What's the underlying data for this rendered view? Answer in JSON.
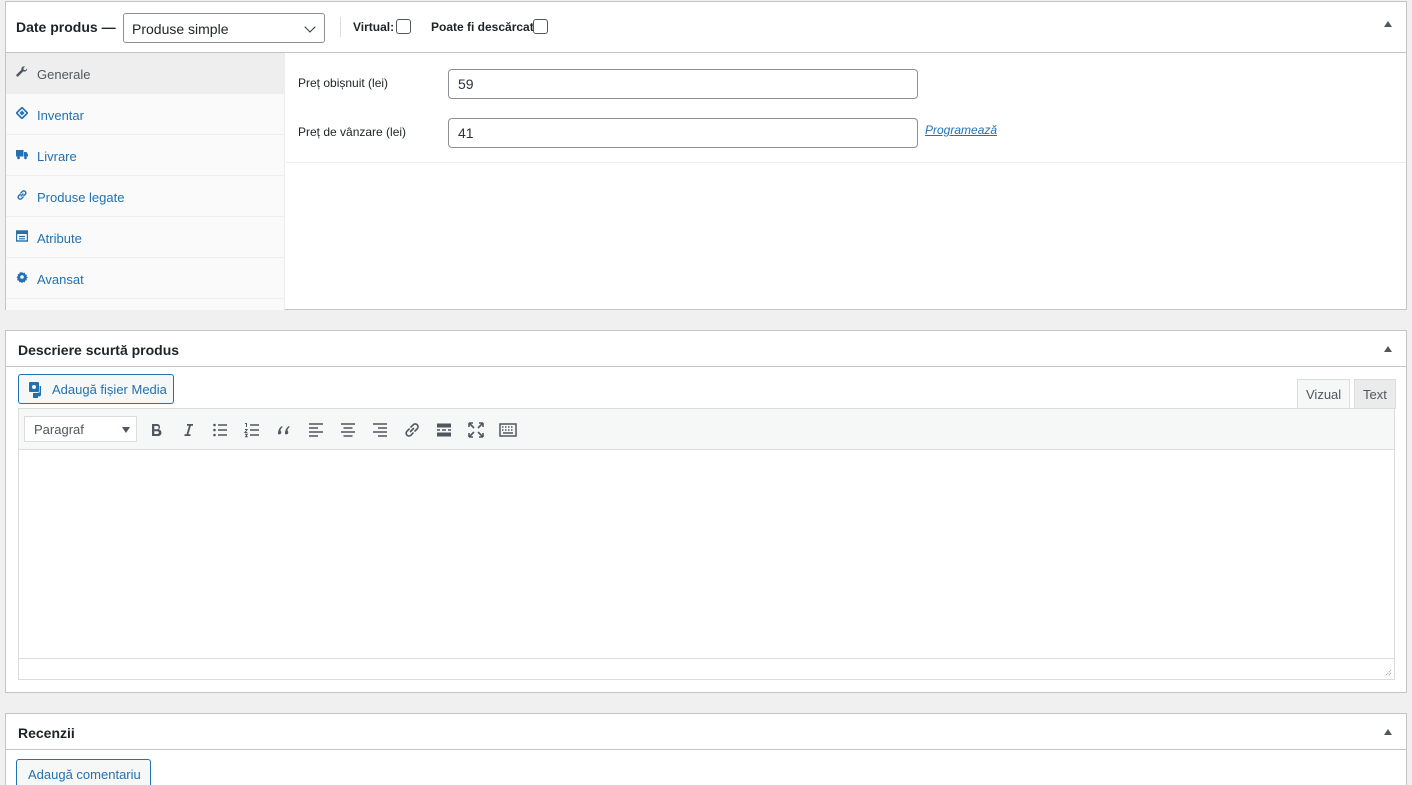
{
  "product_data": {
    "title": "Date produs —",
    "type_select": {
      "value": "Produse simple"
    },
    "virtual_label": "Virtual:",
    "downloadable_label": "Poate fi descărcat:",
    "tabs": [
      {
        "label": "Generale",
        "icon": "wrench-icon",
        "active": true
      },
      {
        "label": "Inventar",
        "icon": "tag-icon",
        "active": false
      },
      {
        "label": "Livrare",
        "icon": "truck-icon",
        "active": false
      },
      {
        "label": "Produse legate",
        "icon": "link-icon",
        "active": false
      },
      {
        "label": "Atribute",
        "icon": "table-icon",
        "active": false
      },
      {
        "label": "Avansat",
        "icon": "gear-icon",
        "active": false
      }
    ],
    "general": {
      "regular_price_label": "Preț obișnuit (lei)",
      "regular_price_value": "59",
      "sale_price_label": "Preț de vânzare (lei)",
      "sale_price_value": "41",
      "schedule_link": "Programează"
    }
  },
  "short_description": {
    "title": "Descriere scurtă produs",
    "add_media_label": "Adaugă fișier Media",
    "tab_visual": "Vizual",
    "tab_text": "Text",
    "format_select": "Paragraf",
    "toolbar": [
      "bold-icon",
      "italic-icon",
      "bullet-list-icon",
      "numbered-list-icon",
      "blockquote-icon",
      "align-left-icon",
      "align-center-icon",
      "align-right-icon",
      "insert-link-icon",
      "read-more-icon",
      "fullscreen-icon",
      "toolbar-toggle-icon"
    ]
  },
  "reviews": {
    "title": "Recenzii",
    "add_comment_label": "Adaugă comentariu"
  }
}
